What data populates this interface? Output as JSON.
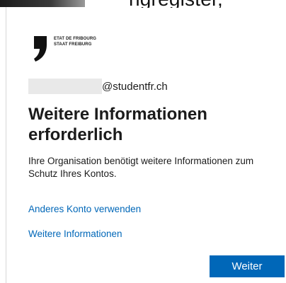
{
  "header": {
    "partial_text": "ngregister,"
  },
  "logo": {
    "icon": "comma-logo-icon",
    "line1": "ETAT DE FRIBOURG",
    "line2": "STAAT FREIBURG"
  },
  "account": {
    "email_domain": "@studentfr.ch"
  },
  "main": {
    "title": "Weitere Informationen erforderlich",
    "description": "Ihre Organisation benötigt weitere Informationen zum Schutz Ihres Kontos.",
    "link_other_account": "Anderes Konto verwenden",
    "link_more_info": "Weitere Informationen",
    "next_button": "Weiter"
  },
  "colors": {
    "accent": "#0067b8",
    "text": "#1b1b1b",
    "redaction": "#e9e9e9"
  }
}
